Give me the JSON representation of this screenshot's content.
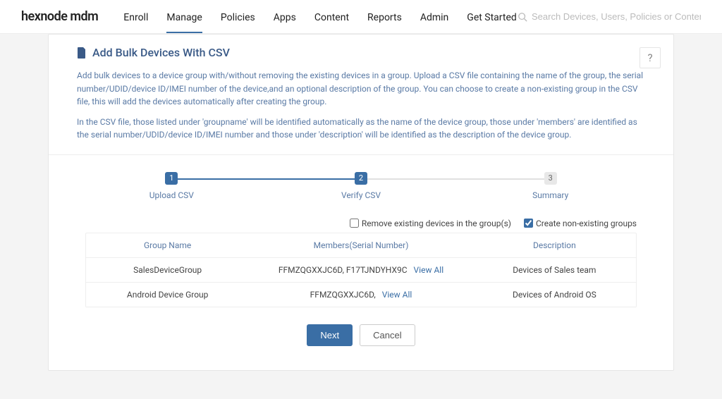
{
  "brand": "hexnode mdm",
  "nav": {
    "items": [
      "Enroll",
      "Manage",
      "Policies",
      "Apps",
      "Content",
      "Reports",
      "Admin",
      "Get Started"
    ],
    "active_index": 1
  },
  "search": {
    "placeholder": "Search Devices, Users, Policies or Content"
  },
  "page": {
    "title": "Add Bulk Devices With CSV",
    "desc1": "Add bulk devices to a device group with/without removing the existing devices in a group. Upload a CSV file containing the name of the group, the serial number/UDID/device ID/IMEI number of the device,and an optional description of the group. You can choose to create a non-existing group in the CSV file, this will add the devices automatically after creating the group.",
    "desc2": "In the CSV file, those listed under 'groupname' will be identified automatically as the name of the device group, those under 'members' are identified as the serial number/UDID/device ID/IMEI number and those under 'description' will be identified as the description of the device group."
  },
  "steps": [
    {
      "num": "1",
      "label": "Upload CSV",
      "state": "done"
    },
    {
      "num": "2",
      "label": "Verify CSV",
      "state": "current"
    },
    {
      "num": "3",
      "label": "Summary",
      "state": "pending"
    }
  ],
  "options": {
    "remove": {
      "label": "Remove existing devices in the group(s)",
      "checked": false
    },
    "create": {
      "label": "Create non-existing groups",
      "checked": true
    }
  },
  "table": {
    "headers": {
      "group": "Group Name",
      "members": "Members(Serial Number)",
      "desc": "Description"
    },
    "rows": [
      {
        "group": "SalesDeviceGroup",
        "members": "FFMZQGXXJC6D, F17TJNDYHX9C",
        "view_all": "View All",
        "desc": "Devices of Sales team"
      },
      {
        "group": "Android Device Group",
        "members": "FFMZQGXXJC6D,",
        "view_all": "View All",
        "desc": "Devices of Android OS"
      }
    ]
  },
  "actions": {
    "next": "Next",
    "cancel": "Cancel"
  },
  "help": "?"
}
